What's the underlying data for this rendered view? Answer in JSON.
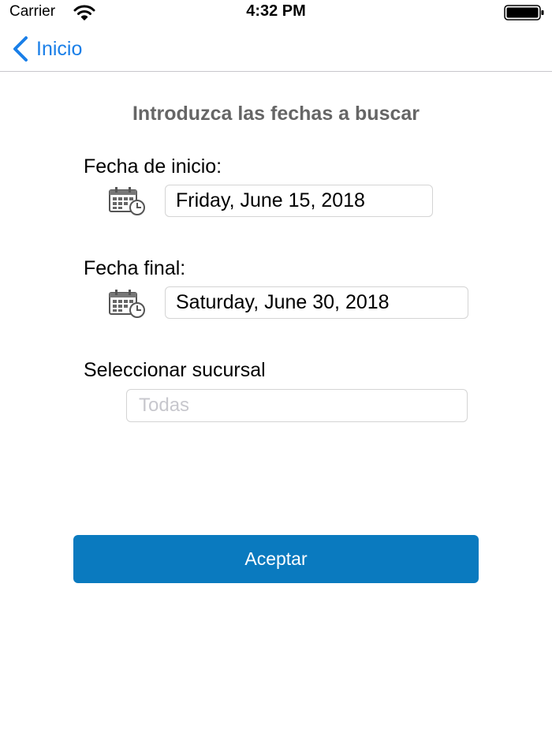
{
  "status_bar": {
    "carrier": "Carrier",
    "time": "4:32 PM"
  },
  "nav": {
    "back_label": "Inicio"
  },
  "form": {
    "heading": "Introduzca las fechas a buscar",
    "start_label": "Fecha de inicio:",
    "start_value": "Friday, June 15, 2018",
    "end_label": "Fecha final:",
    "end_value": "Saturday, June 30, 2018",
    "branch_label": "Seleccionar sucursal",
    "branch_placeholder": "Todas",
    "accept_label": "Aceptar"
  },
  "colors": {
    "accent": "#1a7fe8",
    "button": "#0a7abf",
    "heading": "#666666"
  },
  "icons": [
    "wifi-icon",
    "battery-icon",
    "back-chevron-icon",
    "calendar-icon"
  ]
}
